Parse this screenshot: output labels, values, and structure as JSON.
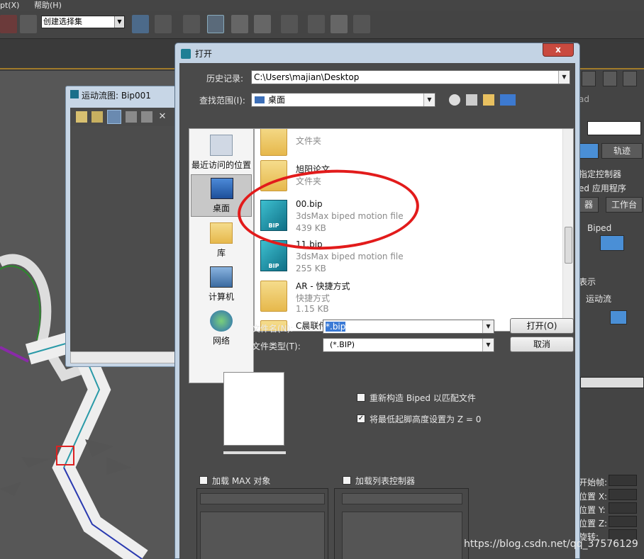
{
  "menubar": {
    "item1": "pt(X)",
    "item2": "帮助(H)"
  },
  "toolbar": {
    "selection_set": "创建选择集"
  },
  "motion_flow": {
    "title": "运动流图: Bip001"
  },
  "command_panel": {
    "label_ad": "ad",
    "tab_track": "轨迹",
    "assign_controller": "指定控制器",
    "biped_app": "ed 应用程序",
    "btn_r": "器",
    "btn_workbench": "工作台",
    "biped_label": "Biped",
    "show_label": "表示",
    "motion_flow_label": "运动流",
    "start_frame": "开始帧:",
    "pos_x": "位置 X:",
    "pos_y": "位置 Y:",
    "pos_z": "位置 Z:",
    "rotation": "旋转:"
  },
  "dialog": {
    "title": "打开",
    "close": "x",
    "history_label": "历史记录:",
    "history_value": "C:\\Users\\majian\\Desktop",
    "lookin_label": "查找范围(I):",
    "lookin_value": "桌面",
    "places": [
      "最近访问的位置",
      "桌面",
      "库",
      "计算机",
      "网络"
    ],
    "files": [
      {
        "name": "",
        "desc": "文件夹",
        "size": ""
      },
      {
        "name": "旭阳论文",
        "desc": "文件夹",
        "size": ""
      },
      {
        "name": "00.bip",
        "desc": "3dsMax biped motion file",
        "size": "439 KB"
      },
      {
        "name": "11.bip",
        "desc": "3dsMax biped motion file",
        "size": "255 KB"
      },
      {
        "name": "AR - 快捷方式",
        "desc": "快捷方式",
        "size": "1.15 KB"
      },
      {
        "name": "C晨联传媒科技 - 快捷方式",
        "desc": "",
        "size": ""
      }
    ],
    "bip_icon_label": "BIP",
    "filename_label": "文件名(N):",
    "filename_value": "*.bip",
    "filetype_label": "文件类型(T):",
    "filetype_value": "(*.BIP)",
    "open_button": "打开(O)",
    "cancel_button": "取消",
    "option_rebuild": "重新构造 Biped 以匹配文件",
    "option_rebuild_checked": false,
    "option_z0": "将最低起脚高度设置为 Z = 0",
    "option_z0_checked": true,
    "load_max_objects": "加载 MAX 对象",
    "load_list_controller": "加载列表控制器"
  },
  "watermark": "https://blog.csdn.net/qq_37576129",
  "colors": {
    "annotation_red": "#e21b1b",
    "dialog_frame": "#c3d3e4",
    "dark_panel": "#4a4a4a"
  }
}
